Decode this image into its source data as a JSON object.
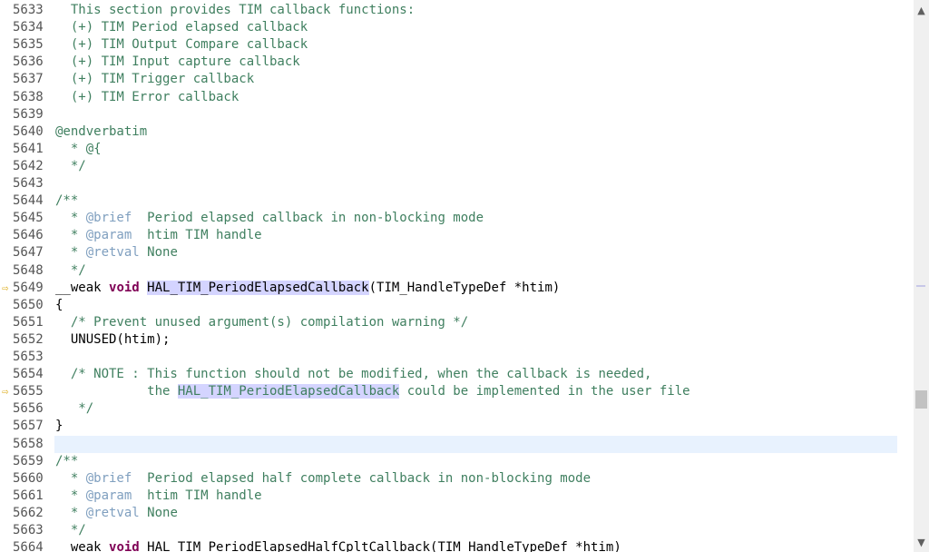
{
  "editor": {
    "lines": [
      {
        "num": "5633",
        "marker": "",
        "segs": [
          {
            "c": "cmt",
            "t": "  This section provides TIM callback functions:"
          }
        ]
      },
      {
        "num": "5634",
        "marker": "",
        "segs": [
          {
            "c": "cmt",
            "t": "  (+) TIM Period elapsed callback"
          }
        ]
      },
      {
        "num": "5635",
        "marker": "",
        "segs": [
          {
            "c": "cmt",
            "t": "  (+) TIM Output Compare callback"
          }
        ]
      },
      {
        "num": "5636",
        "marker": "",
        "segs": [
          {
            "c": "cmt",
            "t": "  (+) TIM Input capture callback"
          }
        ]
      },
      {
        "num": "5637",
        "marker": "",
        "segs": [
          {
            "c": "cmt",
            "t": "  (+) TIM Trigger callback"
          }
        ]
      },
      {
        "num": "5638",
        "marker": "",
        "segs": [
          {
            "c": "cmt",
            "t": "  (+) TIM Error callback"
          }
        ]
      },
      {
        "num": "5639",
        "marker": "",
        "segs": []
      },
      {
        "num": "5640",
        "marker": "",
        "segs": [
          {
            "c": "cmt",
            "t": "@endverbatim"
          }
        ]
      },
      {
        "num": "5641",
        "marker": "",
        "segs": [
          {
            "c": "cmt",
            "t": "  * @{"
          }
        ]
      },
      {
        "num": "5642",
        "marker": "",
        "segs": [
          {
            "c": "cmt",
            "t": "  */"
          }
        ]
      },
      {
        "num": "5643",
        "marker": "",
        "segs": []
      },
      {
        "num": "5644",
        "marker": "",
        "segs": [
          {
            "c": "cmt",
            "t": "/**"
          }
        ]
      },
      {
        "num": "5645",
        "marker": "",
        "segs": [
          {
            "c": "cmt",
            "t": "  * "
          },
          {
            "c": "tag",
            "t": "@brief"
          },
          {
            "c": "cmt",
            "t": "  Period elapsed callback in non-blocking mode"
          }
        ]
      },
      {
        "num": "5646",
        "marker": "",
        "segs": [
          {
            "c": "cmt",
            "t": "  * "
          },
          {
            "c": "tag",
            "t": "@param"
          },
          {
            "c": "cmt",
            "t": "  htim TIM handle"
          }
        ]
      },
      {
        "num": "5647",
        "marker": "",
        "segs": [
          {
            "c": "cmt",
            "t": "  * "
          },
          {
            "c": "tag",
            "t": "@retval"
          },
          {
            "c": "cmt",
            "t": " None"
          }
        ]
      },
      {
        "num": "5648",
        "marker": "",
        "segs": [
          {
            "c": "cmt",
            "t": "  */"
          }
        ]
      },
      {
        "num": "5649",
        "marker": "⇨",
        "segs": [
          {
            "c": "plain",
            "t": "__weak "
          },
          {
            "c": "kw",
            "t": "void"
          },
          {
            "c": "plain",
            "t": " "
          },
          {
            "c": "hl",
            "t": "HAL_TIM_PeriodElapsedCallback"
          },
          {
            "c": "plain",
            "t": "(TIM_HandleTypeDef *htim)"
          }
        ]
      },
      {
        "num": "5650",
        "marker": "",
        "segs": [
          {
            "c": "plain",
            "t": "{"
          }
        ]
      },
      {
        "num": "5651",
        "marker": "",
        "segs": [
          {
            "c": "cmt",
            "t": "  /* Prevent unused argument(s) compilation warning */"
          }
        ]
      },
      {
        "num": "5652",
        "marker": "",
        "segs": [
          {
            "c": "plain",
            "t": "  UNUSED(htim);"
          }
        ]
      },
      {
        "num": "5653",
        "marker": "",
        "segs": []
      },
      {
        "num": "5654",
        "marker": "",
        "segs": [
          {
            "c": "cmt",
            "t": "  /* NOTE : This function should not be modified, when the callback is needed,"
          }
        ]
      },
      {
        "num": "5655",
        "marker": "⇨",
        "segs": [
          {
            "c": "cmt",
            "t": "            the "
          },
          {
            "c": "hl cmt",
            "t": "HAL_TIM_PeriodElapsedCallback"
          },
          {
            "c": "cmt",
            "t": " could be implemented in the user file"
          }
        ]
      },
      {
        "num": "5656",
        "marker": "",
        "segs": [
          {
            "c": "cmt",
            "t": "   */"
          }
        ]
      },
      {
        "num": "5657",
        "marker": "",
        "segs": [
          {
            "c": "plain",
            "t": "}"
          }
        ]
      },
      {
        "num": "5658",
        "marker": "",
        "current": true,
        "segs": []
      },
      {
        "num": "5659",
        "marker": "",
        "segs": [
          {
            "c": "cmt",
            "t": "/**"
          }
        ]
      },
      {
        "num": "5660",
        "marker": "",
        "segs": [
          {
            "c": "cmt",
            "t": "  * "
          },
          {
            "c": "tag",
            "t": "@brief"
          },
          {
            "c": "cmt",
            "t": "  Period elapsed half complete callback in non-blocking mode"
          }
        ]
      },
      {
        "num": "5661",
        "marker": "",
        "segs": [
          {
            "c": "cmt",
            "t": "  * "
          },
          {
            "c": "tag",
            "t": "@param"
          },
          {
            "c": "cmt",
            "t": "  htim TIM handle"
          }
        ]
      },
      {
        "num": "5662",
        "marker": "",
        "segs": [
          {
            "c": "cmt",
            "t": "  * "
          },
          {
            "c": "tag",
            "t": "@retval"
          },
          {
            "c": "cmt",
            "t": " None"
          }
        ]
      },
      {
        "num": "5663",
        "marker": "",
        "segs": [
          {
            "c": "cmt",
            "t": "  */"
          }
        ]
      },
      {
        "num": "5664",
        "marker": "",
        "segs": [
          {
            "c": "plain",
            "t": "__weak "
          },
          {
            "c": "kw",
            "t": "void"
          },
          {
            "c": "plain",
            "t": " HAL_TIM_PeriodElapsedHalfCpltCallback(TIM_HandleTypeDef *htim)"
          }
        ]
      }
    ]
  },
  "scrollbar": {
    "up_icon": "▲",
    "down_icon": "▼"
  },
  "colors": {
    "comment": "#3f7f5f",
    "javadoc_tag": "#7f9fbf",
    "keyword": "#7f0055",
    "occurrence_highlight": "#d4d4ff",
    "current_line": "#e8f2fe"
  }
}
